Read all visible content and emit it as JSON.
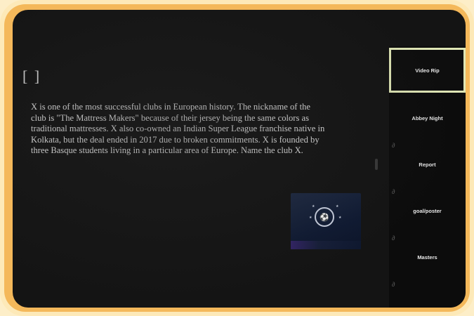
{
  "question": {
    "marker": "[ ]",
    "text": "X is one of the most successful clubs in European history. The nickname of the club is \"The Mattress Makers\" because of their jersey being the same colors as traditional mattresses. X also co-owned an Indian Super League franchise native in Kolkata, but the deal ended in 2017 due to broken commitments. X is founded by three Basque students living in a particular area of Europe. Name the club X."
  },
  "thumbnail": {
    "icon": "champions-league-ball-icon"
  },
  "sidebar": {
    "items": [
      {
        "label": "Video Rip",
        "selected": true
      },
      {
        "label": "Abbey Night",
        "selected": false
      },
      {
        "label": "Report",
        "selected": false
      },
      {
        "label": "goal/poster",
        "selected": false
      },
      {
        "label": "Masters",
        "selected": false
      }
    ]
  },
  "colors": {
    "screen_bg": "#141414",
    "frame_outer": "#fde9b8",
    "frame_ring": "#f4b85a",
    "selected_border": "#dfe6b5"
  }
}
